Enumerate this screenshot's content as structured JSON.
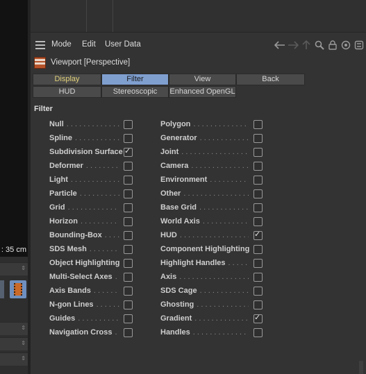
{
  "left_panel": {
    "scale_readout": ": 35 cm"
  },
  "menu": {
    "items": [
      "Mode",
      "Edit",
      "User Data"
    ],
    "nav_icons": [
      "arrow-left-icon",
      "arrow-right-icon",
      "arrow-up-icon",
      "search-icon",
      "lock-icon",
      "target-icon",
      "settings-icon"
    ]
  },
  "viewport": {
    "title": "Viewport [Perspective]"
  },
  "tabs": {
    "row1": [
      "Display",
      "Filter",
      "View",
      "Back"
    ],
    "row2": [
      "HUD",
      "Stereoscopic",
      "Enhanced OpenGL"
    ],
    "selected": "Filter"
  },
  "filter": {
    "heading": "Filter",
    "left": [
      {
        "label": "Null",
        "checked": false
      },
      {
        "label": "Spline",
        "checked": false
      },
      {
        "label": "Subdivision Surface",
        "checked": true
      },
      {
        "label": "Deformer",
        "checked": false
      },
      {
        "label": "Light",
        "checked": false
      },
      {
        "label": "Particle",
        "checked": false
      },
      {
        "label": "Grid",
        "checked": false
      },
      {
        "label": "Horizon",
        "checked": false
      },
      {
        "label": "Bounding-Box",
        "checked": false
      },
      {
        "label": "SDS Mesh",
        "checked": false
      },
      {
        "label": "Object Highlighting",
        "checked": false
      },
      {
        "label": "Multi-Select Axes",
        "checked": false
      },
      {
        "label": "Axis Bands",
        "checked": false
      },
      {
        "label": "N-gon Lines",
        "checked": false
      },
      {
        "label": "Guides",
        "checked": false
      },
      {
        "label": "Navigation Cross",
        "checked": false
      }
    ],
    "right": [
      {
        "label": "Polygon",
        "checked": false
      },
      {
        "label": "Generator",
        "checked": false
      },
      {
        "label": "Joint",
        "checked": false
      },
      {
        "label": "Camera",
        "checked": false
      },
      {
        "label": "Environment",
        "checked": false
      },
      {
        "label": "Other",
        "checked": false
      },
      {
        "label": "Base Grid",
        "checked": false
      },
      {
        "label": "World Axis",
        "checked": false
      },
      {
        "label": "HUD",
        "checked": true
      },
      {
        "label": "Component Highlighting",
        "checked": false
      },
      {
        "label": "Highlight Handles",
        "checked": false
      },
      {
        "label": "Axis",
        "checked": false
      },
      {
        "label": "SDS Cage",
        "checked": false
      },
      {
        "label": "Ghosting",
        "checked": false
      },
      {
        "label": "Gradient",
        "checked": true
      },
      {
        "label": "Handles",
        "checked": false
      }
    ]
  }
}
